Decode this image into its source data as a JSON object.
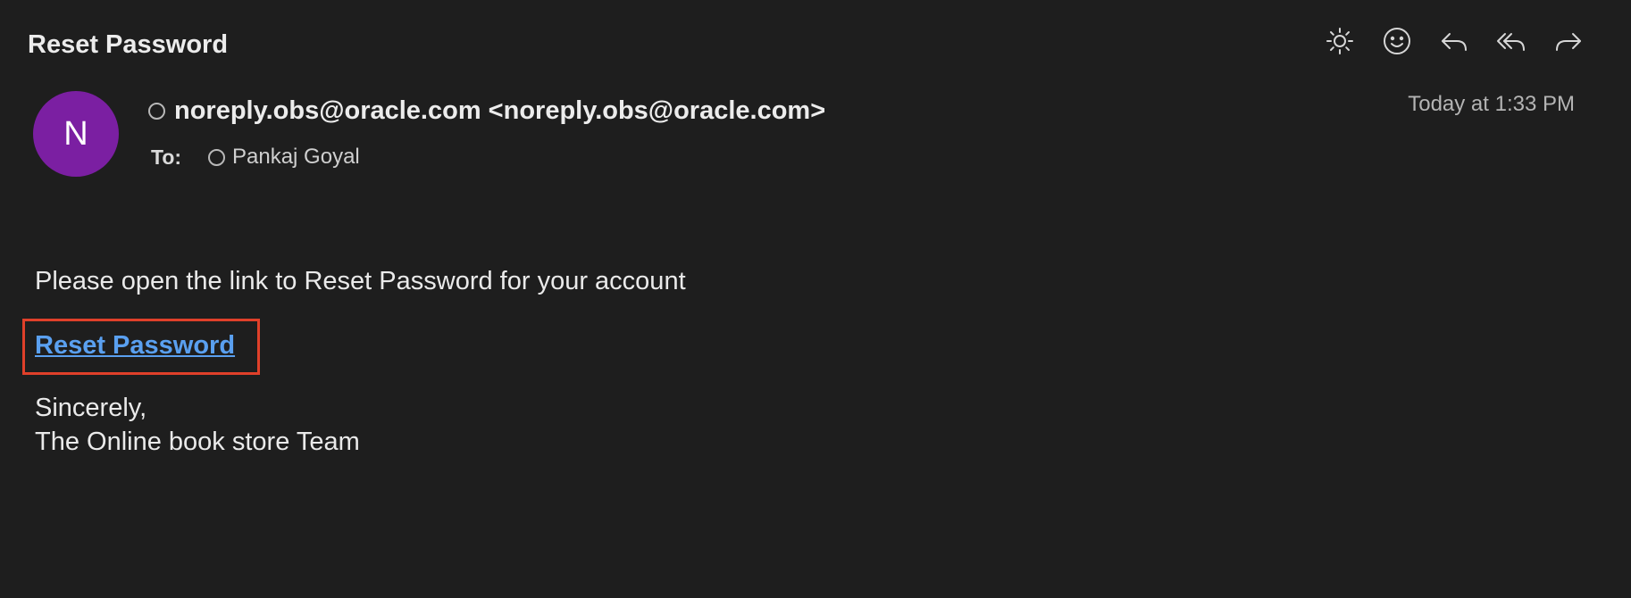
{
  "email": {
    "subject": "Reset Password",
    "from": "noreply.obs@oracle.com <noreply.obs@oracle.com>",
    "avatar_letter": "N",
    "to_label": "To:",
    "to_name": "Pankaj Goyal",
    "date": "Today at 1:33 PM"
  },
  "toolbar": {
    "icons": [
      "brightness-icon",
      "emoji-icon",
      "reply-icon",
      "reply-all-icon",
      "forward-icon"
    ]
  },
  "body": {
    "intro": "Please open the link to Reset Password for your account",
    "link_label": "Reset Password",
    "signoff_line1": "Sincerely,",
    "signoff_line2": "The Online book store Team"
  },
  "colors": {
    "background": "#1e1e1e",
    "avatar": "#7b1fa2",
    "link": "#5aa0f0",
    "highlight_box": "#e0402a"
  }
}
